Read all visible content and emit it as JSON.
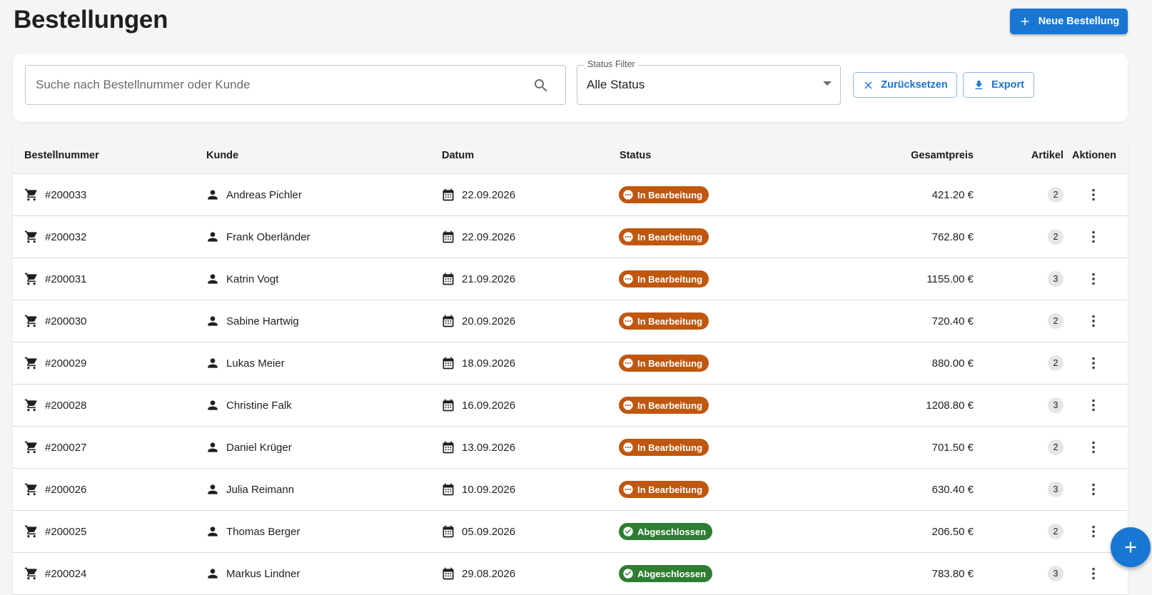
{
  "page": {
    "title": "Bestellungen",
    "new_order_label": "Neue Bestellung"
  },
  "filters": {
    "search_placeholder": "Suche nach Bestellnummer oder Kunde",
    "search_value": "",
    "status_label": "Status Filter",
    "status_value": "Alle Status",
    "reset_label": "Zurücksetzen",
    "export_label": "Export"
  },
  "table": {
    "columns": [
      "Bestellnummer",
      "Kunde",
      "Datum",
      "Status",
      "Gesamtpreis",
      "Artikel",
      "Aktionen"
    ],
    "rows": [
      {
        "order": "#200033",
        "customer": "Andreas Pichler",
        "date": "22.09.2026",
        "status": "In Bearbeitung",
        "status_type": "processing",
        "price": "421.20 €",
        "items": "2"
      },
      {
        "order": "#200032",
        "customer": "Frank Oberländer",
        "date": "22.09.2026",
        "status": "In Bearbeitung",
        "status_type": "processing",
        "price": "762.80 €",
        "items": "2"
      },
      {
        "order": "#200031",
        "customer": "Katrin Vogt",
        "date": "21.09.2026",
        "status": "In Bearbeitung",
        "status_type": "processing",
        "price": "1155.00 €",
        "items": "3"
      },
      {
        "order": "#200030",
        "customer": "Sabine Hartwig",
        "date": "20.09.2026",
        "status": "In Bearbeitung",
        "status_type": "processing",
        "price": "720.40 €",
        "items": "2"
      },
      {
        "order": "#200029",
        "customer": "Lukas Meier",
        "date": "18.09.2026",
        "status": "In Bearbeitung",
        "status_type": "processing",
        "price": "880.00 €",
        "items": "2"
      },
      {
        "order": "#200028",
        "customer": "Christine Falk",
        "date": "16.09.2026",
        "status": "In Bearbeitung",
        "status_type": "processing",
        "price": "1208.80 €",
        "items": "3"
      },
      {
        "order": "#200027",
        "customer": "Daniel Krüger",
        "date": "13.09.2026",
        "status": "In Bearbeitung",
        "status_type": "processing",
        "price": "701.50 €",
        "items": "2"
      },
      {
        "order": "#200026",
        "customer": "Julia Reimann",
        "date": "10.09.2026",
        "status": "In Bearbeitung",
        "status_type": "processing",
        "price": "630.40 €",
        "items": "3"
      },
      {
        "order": "#200025",
        "customer": "Thomas Berger",
        "date": "05.09.2026",
        "status": "Abgeschlossen",
        "status_type": "completed",
        "price": "206.50 €",
        "items": "2"
      },
      {
        "order": "#200024",
        "customer": "Markus Lindner",
        "date": "29.08.2026",
        "status": "Abgeschlossen",
        "status_type": "completed",
        "price": "783.80 €",
        "items": "3"
      }
    ]
  },
  "colors": {
    "primary": "#1976d2",
    "processing": "#c0570f",
    "completed": "#2e7d32"
  },
  "icons": {
    "order": "shopping-cart-icon",
    "customer": "person-icon",
    "date": "calendar-icon",
    "processing": "more-horizontal-circle-icon",
    "completed": "check-circle-icon",
    "actions": "more-vertical-icon",
    "fab": "add-icon"
  }
}
